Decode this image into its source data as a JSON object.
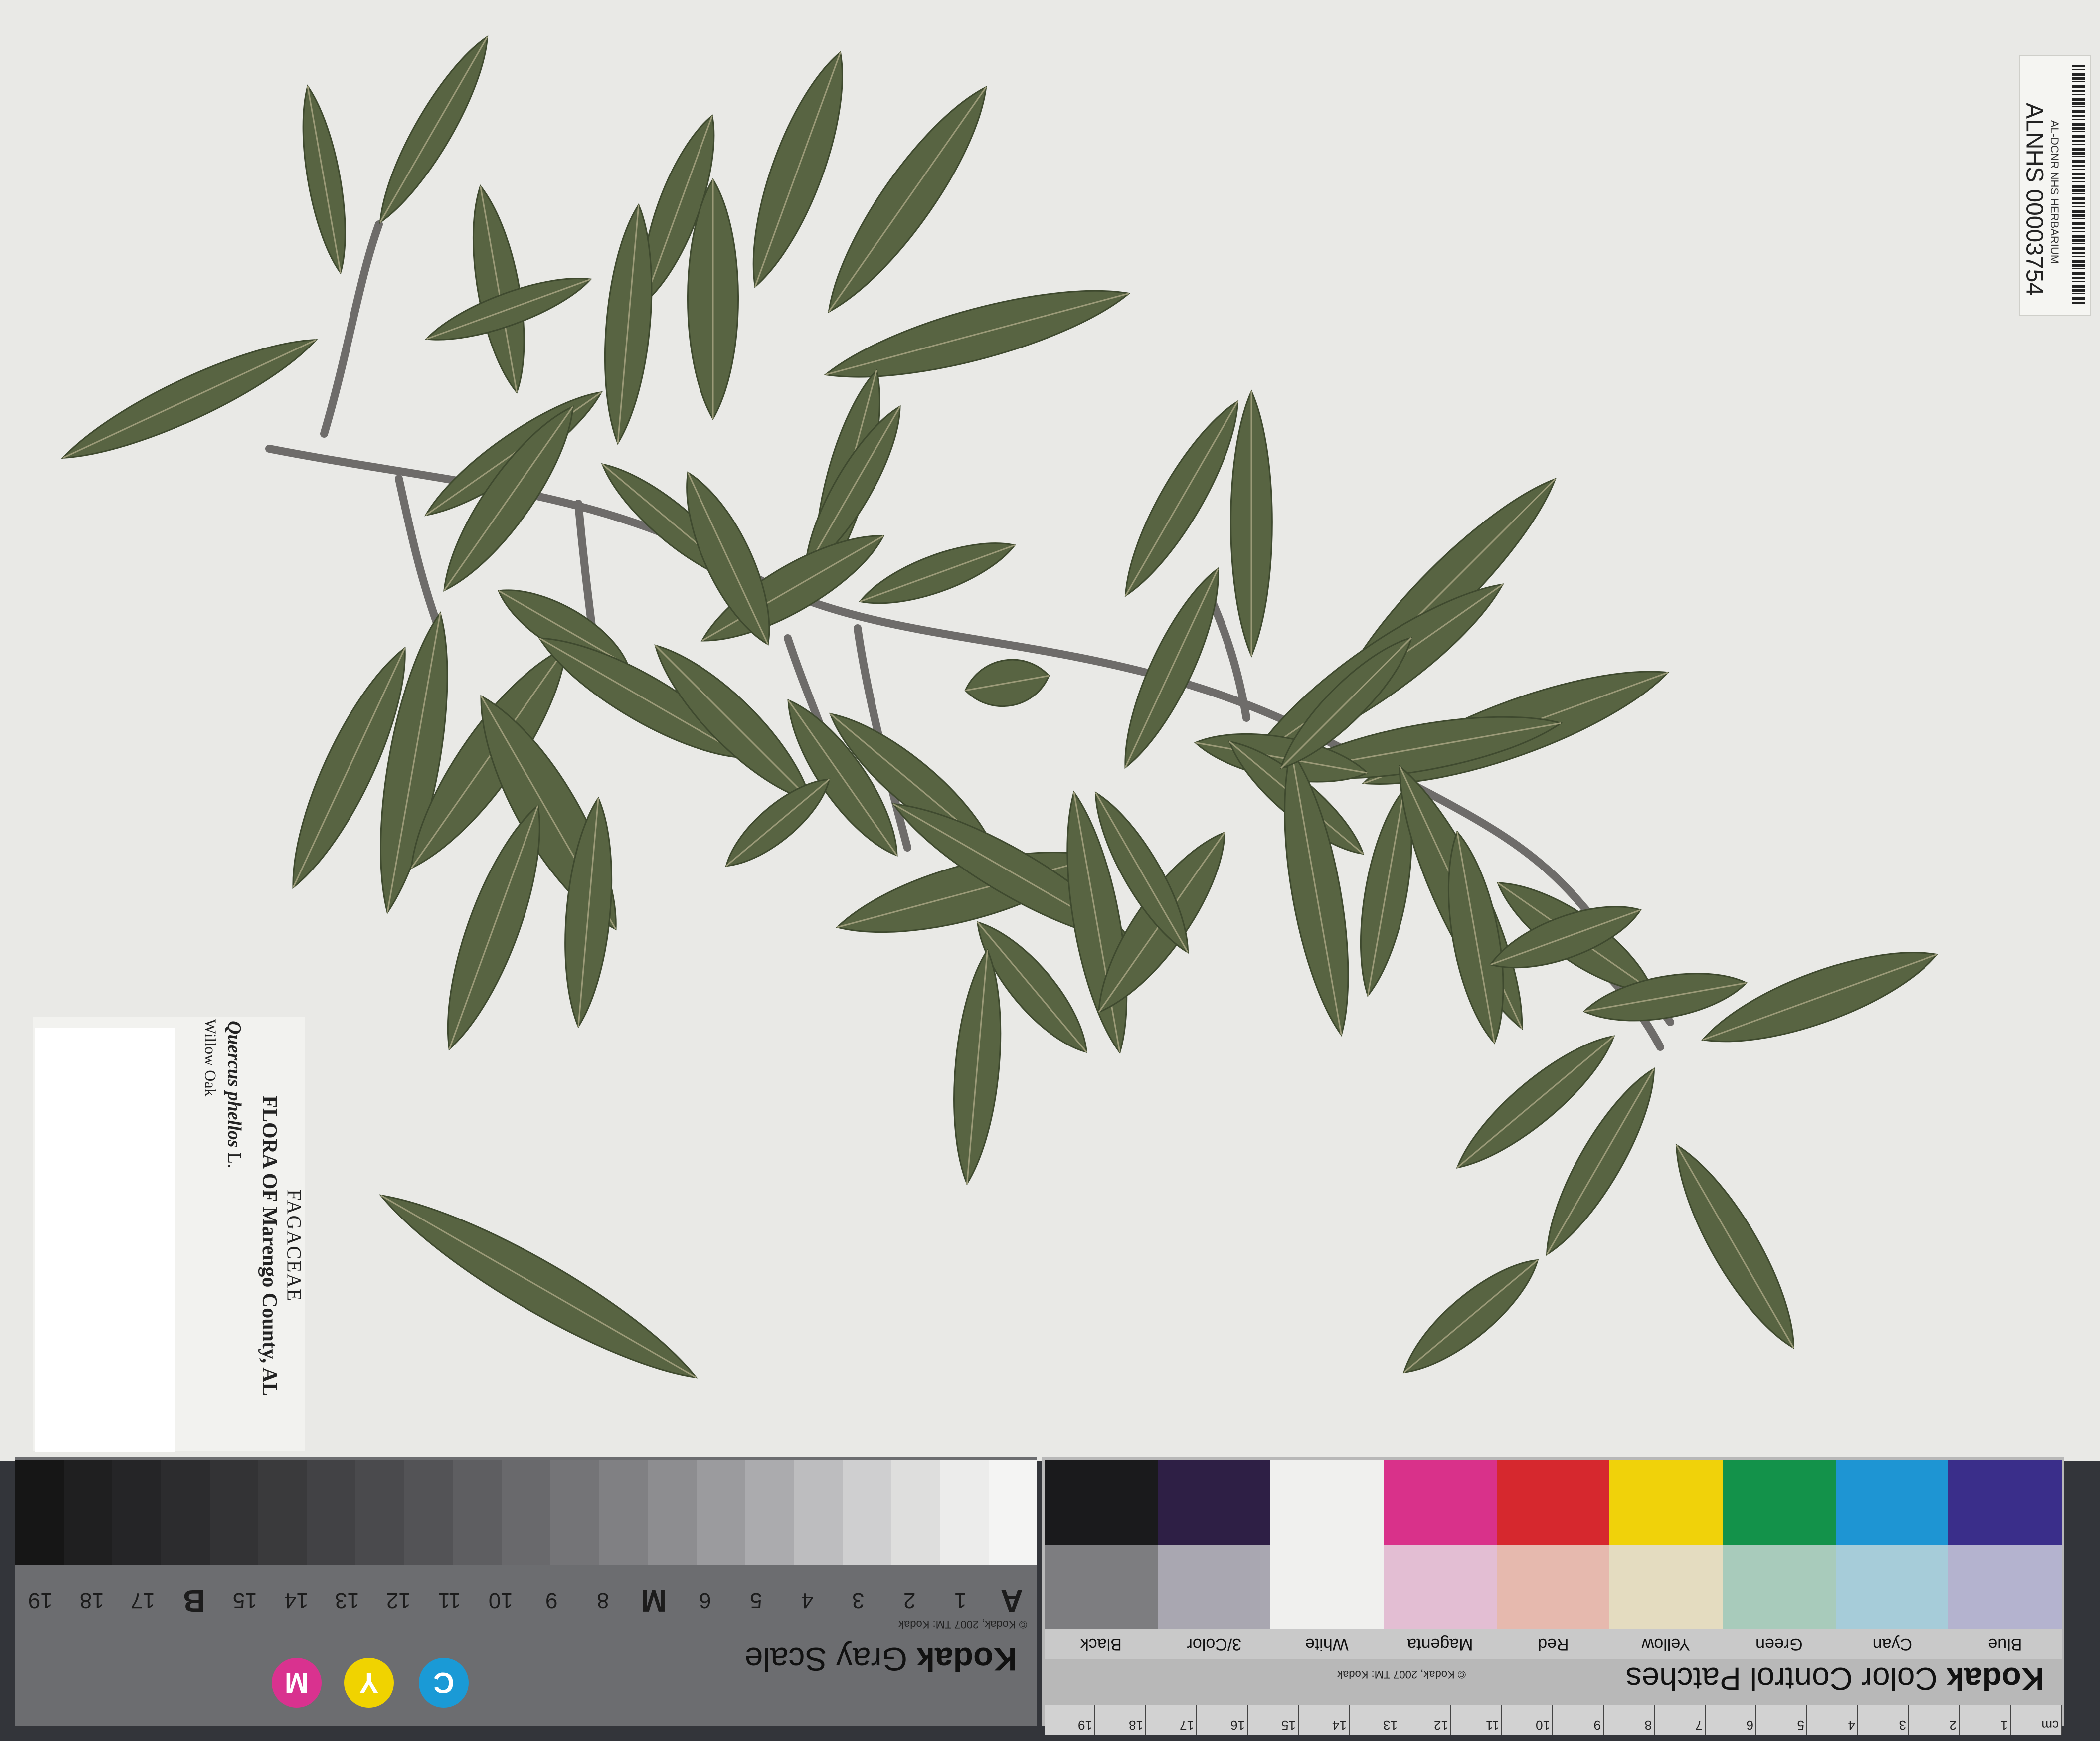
{
  "barcode": {
    "institution": "AL-DCNR NHS HERBARIUM",
    "number": "ALNHS 00003754"
  },
  "label": {
    "family": "FAGACEAE",
    "flora": "FLORA OF Marengo County, AL",
    "scientific_name": "Quercus phellos",
    "author": "L.",
    "common_name": "Willow Oak"
  },
  "gray_scale": {
    "brand": "Kodak",
    "title": "Gray Scale",
    "copyright": "© Kodak, 2007 TM: Kodak",
    "step_colors": [
      "#161616",
      "#1f1f20",
      "#252527",
      "#2c2c2e",
      "#333335",
      "#3a3a3c",
      "#424245",
      "#4a4a4d",
      "#535356",
      "#5e5e61",
      "#69696c",
      "#747477",
      "#808083",
      "#8d8d90",
      "#9b9b9e",
      "#ababae",
      "#bdbdbf",
      "#cfcfd0",
      "#dededd",
      "#ececeb",
      "#f4f4f3"
    ],
    "numbers": [
      "A",
      "1",
      "2",
      "3",
      "4",
      "5",
      "6",
      "M",
      "8",
      "9",
      "10",
      "11",
      "12",
      "13",
      "14",
      "15",
      "B",
      "17",
      "18",
      "19"
    ],
    "cym": [
      "C",
      "Y",
      "M"
    ]
  },
  "color_card": {
    "brand": "Kodak",
    "title": "Color Control Patches",
    "copyright": "© Kodak, 2007 TM: Kodak",
    "top_colors": [
      "#1a1a1c",
      "#2e1f45",
      "#f0f0ee",
      "#d9318a",
      "#d6282e",
      "#f0d20a",
      "#13924a",
      "#1e95d3",
      "#3a2e8a"
    ],
    "bottom_colors": [
      "#7d7d80",
      "#a9a7b1",
      "#f0f0ee",
      "#e3bed3",
      "#e6b9ae",
      "#e4dcc0",
      "#a8cbbb",
      "#a6ccd9",
      "#b4b3cf"
    ],
    "names": [
      "Blue",
      "Cyan",
      "Green",
      "Yellow",
      "Red",
      "Magenta",
      "White",
      "3/Color",
      "Black"
    ],
    "ruler": [
      "cm",
      "1",
      "2",
      "3",
      "4",
      "5",
      "6",
      "7",
      "8",
      "9",
      "10",
      "11",
      "12",
      "13",
      "14",
      "15",
      "16",
      "17",
      "18",
      "19"
    ]
  },
  "leaf_color": "#586442",
  "stem_color": "#6e6c6a"
}
